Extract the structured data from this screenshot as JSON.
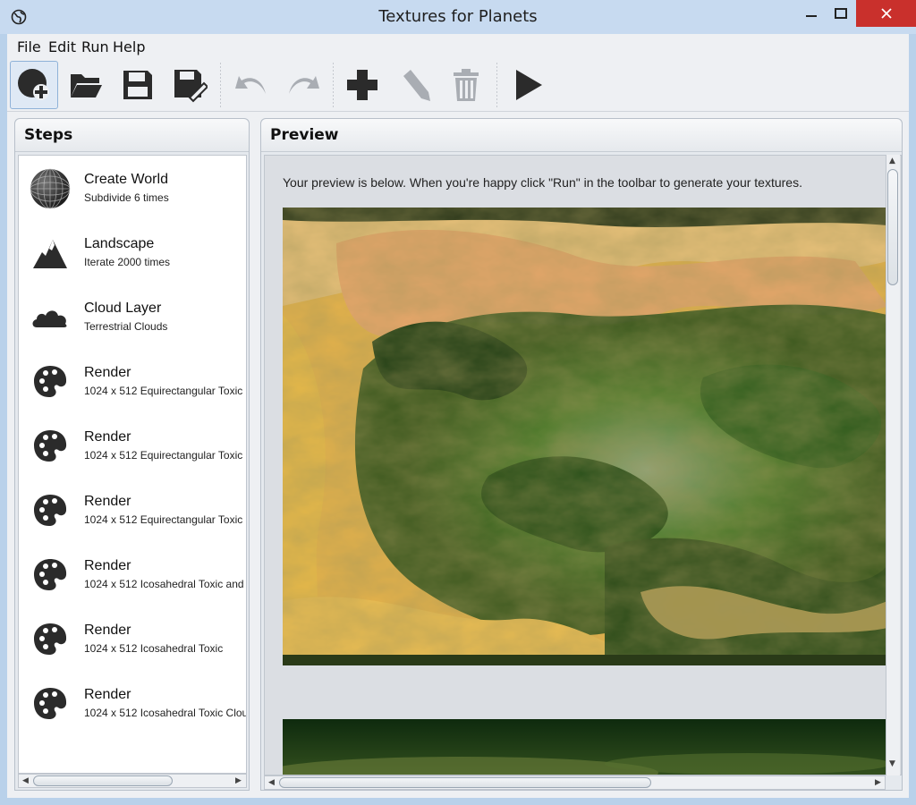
{
  "window": {
    "title": "Textures for Planets"
  },
  "menu": {
    "file": "File",
    "edit": "Edit",
    "run": "Run",
    "help": "Help"
  },
  "toolbar": {
    "buttons": [
      {
        "icon": "new-world-icon"
      },
      {
        "icon": "folder-open-icon"
      },
      {
        "icon": "save-icon"
      },
      {
        "icon": "save-as-icon"
      },
      {
        "icon": "undo-icon"
      },
      {
        "icon": "redo-icon"
      },
      {
        "icon": "add-icon"
      },
      {
        "icon": "edit-icon"
      },
      {
        "icon": "delete-icon"
      },
      {
        "icon": "run-icon"
      }
    ]
  },
  "steps": {
    "title": "Steps",
    "items": [
      {
        "name": "Create World",
        "detail": "Subdivide 6 times",
        "icon": "globe-icon"
      },
      {
        "name": "Landscape",
        "detail": "Iterate 2000 times",
        "icon": "mountain-icon"
      },
      {
        "name": "Cloud Layer",
        "detail": "Terrestrial Clouds",
        "icon": "cloud-icon"
      },
      {
        "name": "Render",
        "detail": "1024 x 512 Equirectangular Toxic",
        "icon": "palette-icon"
      },
      {
        "name": "Render",
        "detail": "1024 x 512 Equirectangular Toxic",
        "icon": "palette-icon"
      },
      {
        "name": "Render",
        "detail": "1024 x 512 Equirectangular Toxic",
        "icon": "palette-icon"
      },
      {
        "name": "Render",
        "detail": "1024 x 512 Icosahedral Toxic and",
        "icon": "palette-icon"
      },
      {
        "name": "Render",
        "detail": "1024 x 512 Icosahedral Toxic",
        "icon": "palette-icon"
      },
      {
        "name": "Render",
        "detail": "1024 x 512 Icosahedral Toxic Clou",
        "icon": "palette-icon"
      }
    ]
  },
  "preview": {
    "title": "Preview",
    "message": "Your preview is below. When you're happy click \"Run\" in the toolbar to generate your textures."
  },
  "colors": {
    "titlebar": "#c7daf0",
    "close": "#c9302c",
    "icon": "#2b2b2b"
  }
}
